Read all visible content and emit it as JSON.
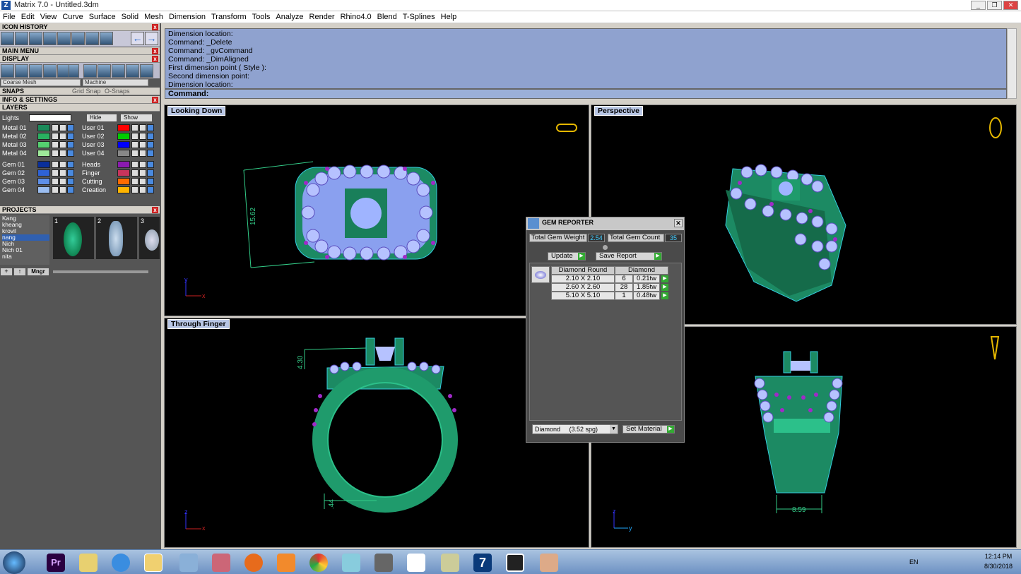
{
  "window": {
    "title": "Matrix 7.0 - Untitled.3dm",
    "minimize": "_",
    "restore": "❐",
    "close": "✕"
  },
  "menu": [
    "File",
    "Edit",
    "View",
    "Curve",
    "Surface",
    "Solid",
    "Mesh",
    "Dimension",
    "Transform",
    "Tools",
    "Analyze",
    "Render",
    "Rhino4.0",
    "Blend",
    "T-Splines",
    "Help"
  ],
  "left": {
    "icon_history": "ICON HISTORY",
    "main_menu": "MAIN MENU",
    "display": "DISPLAY",
    "mesh_mode": "Coarse Mesh",
    "render_mode": "Machine",
    "snaps": "SNAPS",
    "grid_snap": "Grid Snap",
    "osnaps": "O-Snaps",
    "info": "INFO & SETTINGS",
    "layers": "LAYERS",
    "lights": "Lights",
    "hide": "Hide",
    "show": "Show",
    "layers_left": [
      {
        "name": "Metal 01",
        "color": "#1a8a5a"
      },
      {
        "name": "Metal 02",
        "color": "#29b060"
      },
      {
        "name": "Metal 03",
        "color": "#55d070"
      },
      {
        "name": "Metal 04",
        "color": "#9ee89a"
      },
      {
        "name": "Gem 01",
        "color": "#0a2f9a"
      },
      {
        "name": "Gem 02",
        "color": "#2e62d6"
      },
      {
        "name": "Gem 03",
        "color": "#5e8fe8"
      },
      {
        "name": "Gem 04",
        "color": "#9bbdf0"
      }
    ],
    "layers_right": [
      {
        "name": "User 01",
        "color": "#ff0000"
      },
      {
        "name": "User 02",
        "color": "#00cc00"
      },
      {
        "name": "User 03",
        "color": "#0000ff"
      },
      {
        "name": "User 04",
        "color": "#888888"
      },
      {
        "name": "Heads",
        "color": "#8a1ab0"
      },
      {
        "name": "Finger",
        "color": "#c8345c"
      },
      {
        "name": "Cutting",
        "color": "#ff6a00"
      },
      {
        "name": "Creation",
        "color": "#ffb400"
      }
    ],
    "projects": "PROJECTS",
    "project_names": [
      "Kang",
      "kheang",
      "krovil",
      "nang",
      "Nich",
      "Nich 01",
      "nita"
    ],
    "project_thumbs": [
      "1",
      "2",
      "3"
    ],
    "mngr": "Mngr"
  },
  "command": {
    "history": [
      "Dimension location:",
      "Command: _Delete",
      "Command: _gvCommand",
      "Command: _DimAligned",
      "First dimension point ( Style ):",
      "Second dimension point:",
      "Dimension location:"
    ],
    "prompt": "Command:"
  },
  "viewports": {
    "top_left": "Looking Down",
    "top_right": "Perspective",
    "bottom_left": "Through Finger",
    "dim_15": "15.62",
    "dim_4": "4.30",
    "dim_44": ".44",
    "dim_859": "8.59",
    "axis_x": "x",
    "axis_y": "y",
    "axis_z": "z"
  },
  "gem_reporter": {
    "title": "GEM REPORTER",
    "weight_label": "Total Gem Weight",
    "weight": "2.54",
    "count_label": "Total Gem Count",
    "count": "35",
    "update": "Update",
    "save_report": "Save Report",
    "shape_header": "Diamond Round",
    "material_header": "Diamond",
    "rows": [
      {
        "size": "2.10 X 2.10",
        "qty": "6",
        "tw": "0.21tw"
      },
      {
        "size": "2.60 X 2.60",
        "qty": "28",
        "tw": "1.85tw"
      },
      {
        "size": "5.10 X 5.10",
        "qty": "1",
        "tw": "0.48tw"
      }
    ],
    "material_select": "Diamond     (3.52 spg)",
    "set_material": "Set Material"
  },
  "taskbar": {
    "lang": "EN",
    "time": "12:14 PM",
    "date": "8/30/2018",
    "pr": "Pr"
  }
}
